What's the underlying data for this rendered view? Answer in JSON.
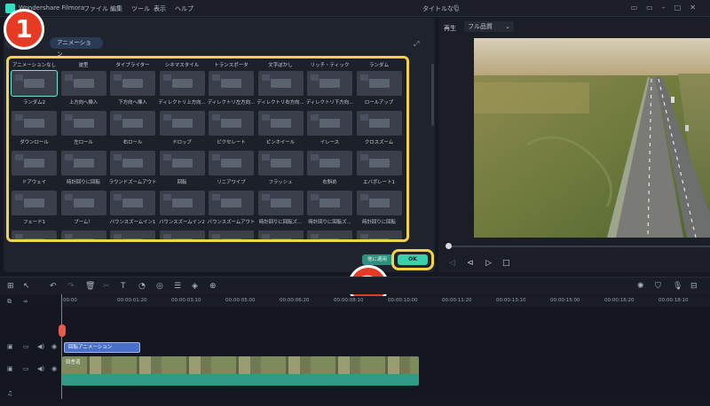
{
  "app": {
    "title": "Wondershare Filmora",
    "menus": [
      "ファイル",
      "編集",
      "ツール",
      "表示",
      "ヘルプ"
    ],
    "project": "タイトルなし"
  },
  "left_panel": {
    "tabs": [
      "アニメーション"
    ],
    "headers": [
      "アニメーションなし",
      "波型",
      "タイプライター",
      "シネマスタイル",
      "トランスポータ",
      "文字ぼかし",
      "リッチ・ティック",
      "ランダム"
    ],
    "rows": [
      [
        "ランダム2",
        "上方向へ挿入",
        "下方向へ挿入",
        "ディレクトリ上方向...",
        "ディレクトリ左方向...",
        "ディレクトリ右方向...",
        "ディレクトリ下方向...",
        "ロールアップ"
      ],
      [
        "ダウンロール",
        "左ロール",
        "右ロール",
        "ドロップ",
        "ピクセレート",
        "ピンホイール",
        "イレース",
        "クロスズーム"
      ],
      [
        "ドアウェイ",
        "時計回りに回転",
        "ラウンドズームアウト",
        "回転",
        "リニアワイプ",
        "フラッシュ",
        "右斜め",
        "エバポレート1"
      ],
      [
        "フェード1",
        "ブーム！",
        "バウンスズームイン1",
        "バウンスズームイン2",
        "バウンスズームアウト",
        "時計回りに回転ズ...",
        "時計回りに回転ズ...",
        "時計回りに回転"
      ]
    ],
    "apply_label": "他に適用",
    "ok_label": "OK"
  },
  "badges": {
    "one": "1",
    "two": "2"
  },
  "preview": {
    "label": "再生",
    "quality": "フル品質"
  },
  "ruler": [
    "00:00",
    "00:00:01:20",
    "00:00:03:10",
    "00:00:05:00",
    "00:00:06:20",
    "00:00:08:10",
    "00:00:10:00",
    "00:00:11:20",
    "00:00:13:10",
    "00:00:15:00",
    "00:00:16:20",
    "00:00:18:10",
    "00:00:20:00"
  ],
  "timeline": {
    "text_clip": "回転アニメーション",
    "video_clip": "田舎道"
  },
  "colors": {
    "accent": "#3ad0ae",
    "highlight": "#f2d24a",
    "badge": "#e63a23"
  }
}
